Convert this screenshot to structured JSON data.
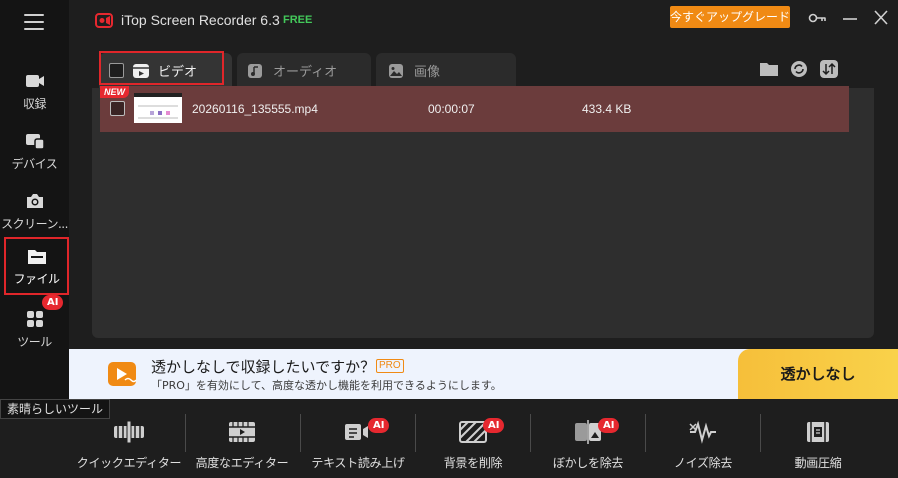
{
  "app": {
    "title": "iTop Screen Recorder 6.3",
    "edition": "FREE",
    "upgrade_label": "今すぐアップグレード",
    "accent": "#e0262a",
    "upgrade_color": "#f08a14"
  },
  "sidebar": {
    "items": [
      {
        "label": "収録",
        "icon": "video-camera-icon"
      },
      {
        "label": "デバイス",
        "icon": "devices-icon"
      },
      {
        "label": "スクリーン...",
        "icon": "camera-icon"
      },
      {
        "label": "ファイル",
        "icon": "file-icon",
        "active": true
      },
      {
        "label": "ツール",
        "icon": "tools-icon",
        "badge": "AI"
      }
    ]
  },
  "tabs": [
    {
      "label": "ビデオ",
      "icon": "clapper-icon",
      "active": true
    },
    {
      "label": "オーディオ",
      "icon": "music-note-icon"
    },
    {
      "label": "画像",
      "icon": "image-icon"
    }
  ],
  "files": [
    {
      "badge": "NEW",
      "name": "20260116_135555.mp4",
      "duration": "00:00:07",
      "size": "433.4 KB"
    }
  ],
  "promo": {
    "title": "透かしなしで収録したいですか？",
    "badge": "PRO",
    "subtitle": "「PRO」を有効にして、高度な透かし機能を利用できるようにします。",
    "button": "透かしなし"
  },
  "tooltip": "素晴らしいツール",
  "tools": [
    {
      "label": "クイックエディター",
      "icon": "quick-editor-icon"
    },
    {
      "label": "高度なエディター",
      "icon": "advanced-editor-icon"
    },
    {
      "label": "テキスト読み上げ",
      "icon": "text-to-speech-icon",
      "badge": "AI"
    },
    {
      "label": "背景を削除",
      "icon": "remove-background-icon",
      "badge": "AI"
    },
    {
      "label": "ぼかしを除去",
      "icon": "remove-blur-icon",
      "badge": "AI"
    },
    {
      "label": "ノイズ除去",
      "icon": "noise-removal-icon"
    },
    {
      "label": "動画圧縮",
      "icon": "video-compress-icon"
    }
  ]
}
